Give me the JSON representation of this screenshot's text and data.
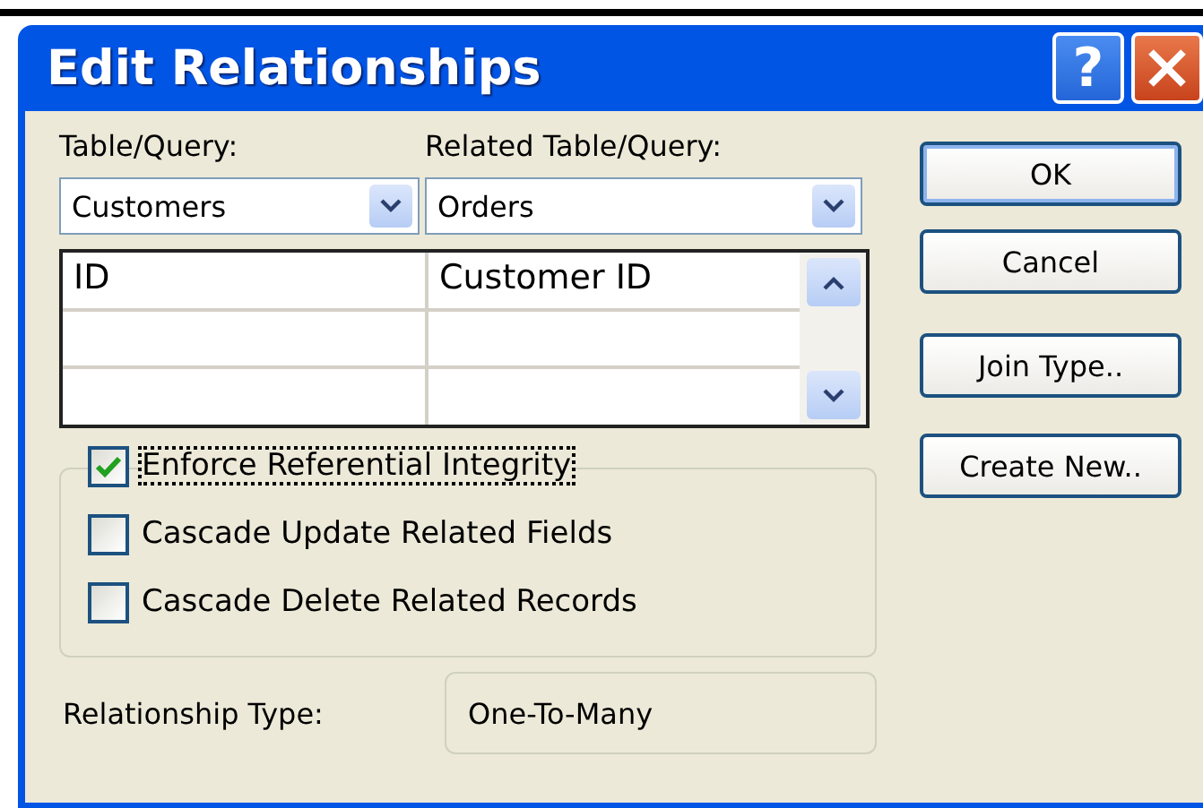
{
  "window": {
    "title": "Edit Relationships",
    "title_buttons": [
      {
        "kind": "help",
        "label": "?"
      },
      {
        "kind": "close"
      }
    ]
  },
  "table_label": {
    "text": "Table/Query:"
  },
  "related_label": {
    "text": "Related Table/Query:"
  },
  "table_combo": {
    "value": "Customers"
  },
  "related_combo": {
    "value": "Orders"
  },
  "grid": {
    "rows": [
      [
        "ID",
        "Customer ID"
      ],
      [
        "",
        ""
      ],
      [
        "",
        ""
      ]
    ]
  },
  "options": [
    {
      "label": "Enforce Referential Integrity",
      "checked": true,
      "focused": true
    },
    {
      "label": "Cascade Update Related Fields",
      "checked": false,
      "focused": false
    },
    {
      "label": "Cascade Delete Related Records",
      "checked": false,
      "focused": false
    }
  ],
  "relationship_type": {
    "label": "Relationship Type:",
    "value": "One-To-Many"
  },
  "buttons": [
    {
      "label": "OK",
      "default": true
    },
    {
      "label": "Cancel",
      "default": false
    },
    {
      "label": "Join Type..",
      "default": false
    },
    {
      "label": "Create New..",
      "default": false
    }
  ]
}
